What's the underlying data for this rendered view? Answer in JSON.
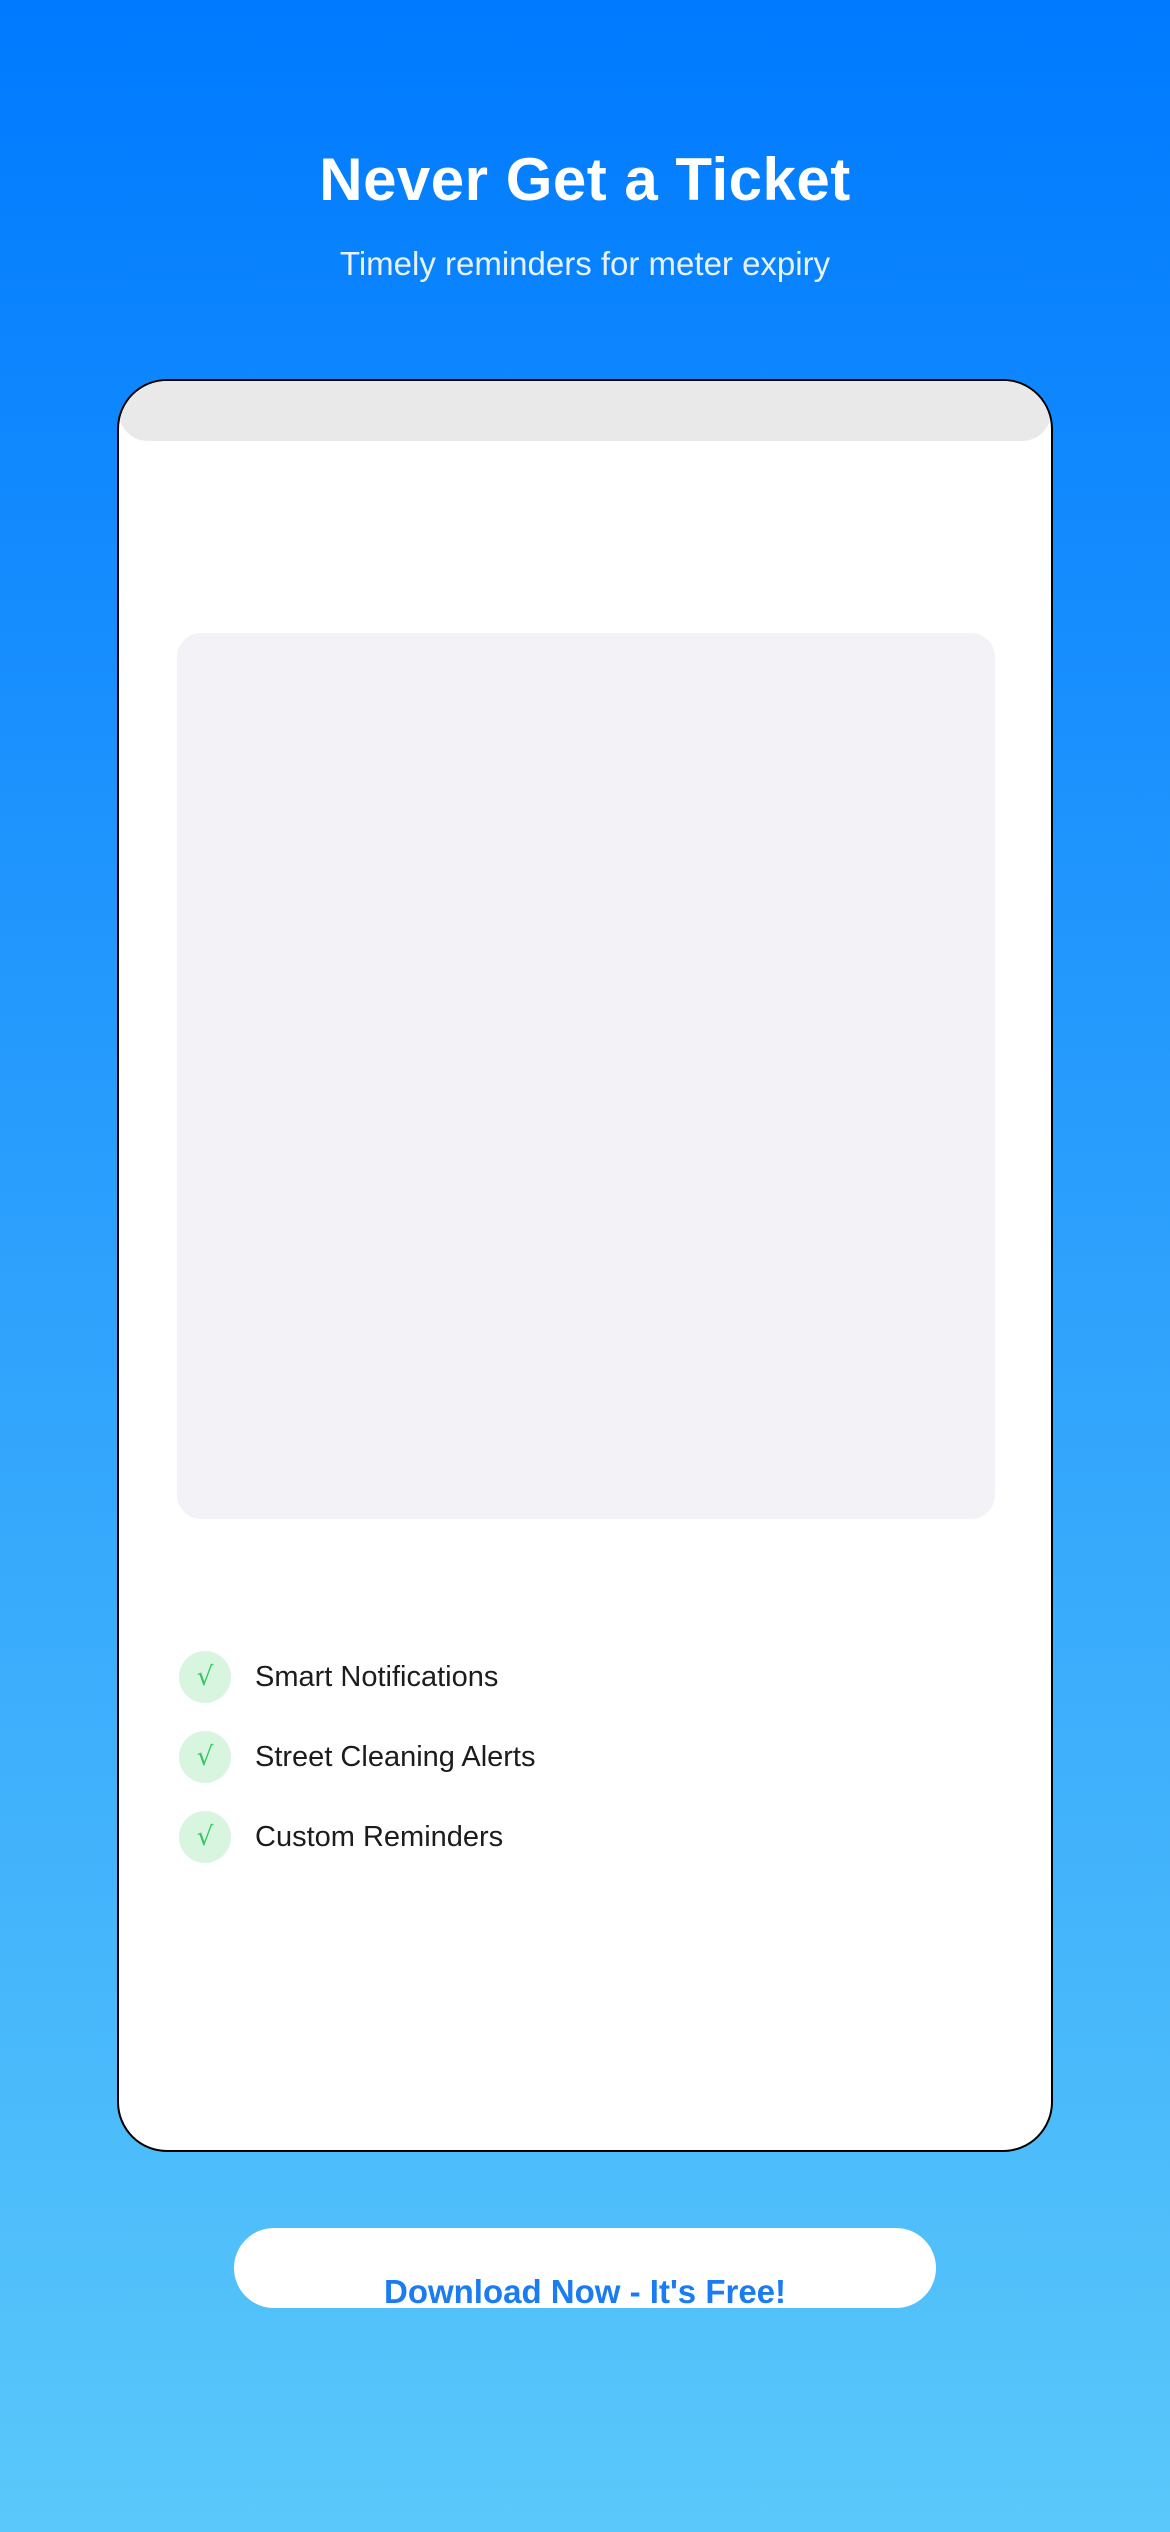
{
  "header": {
    "title": "Never Get a Ticket",
    "subtitle": "Timely reminders for meter expiry"
  },
  "features": [
    {
      "icon": "checkmark-icon",
      "glyph": "√",
      "label": "Smart Notifications"
    },
    {
      "icon": "checkmark-icon",
      "glyph": "√",
      "label": "Street Cleaning Alerts"
    },
    {
      "icon": "checkmark-icon",
      "glyph": "√",
      "label": "Custom Reminders"
    }
  ],
  "cta": {
    "label": "Download Now - It's Free!"
  },
  "colors": {
    "gradient_top": "#007aff",
    "gradient_bottom": "#5ac8fa",
    "check_green": "#34c759",
    "check_bg": "#d8f5e0",
    "cta_text": "#1a7cf0"
  }
}
